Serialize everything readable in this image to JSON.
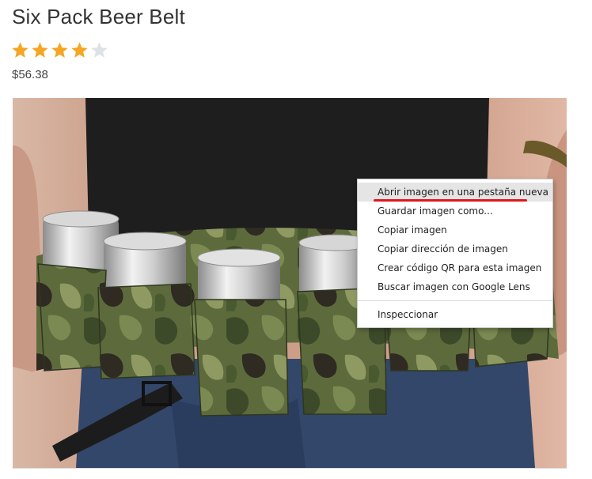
{
  "product": {
    "title": "Six Pack Beer Belt",
    "price": "$56.38",
    "rating": 4,
    "rating_max": 5
  },
  "colors": {
    "star_filled": "#f5a623",
    "star_empty": "#dde3e5",
    "highlight_underline": "#e0161b",
    "menu_hover": "#e5e5e5"
  },
  "context_menu": {
    "items": [
      {
        "label": "Abrir imagen en una pestaña nueva"
      },
      {
        "label": "Guardar imagen como..."
      },
      {
        "label": "Copiar imagen"
      },
      {
        "label": "Copiar dirección de imagen"
      },
      {
        "label": "Crear código QR para esta imagen"
      },
      {
        "label": "Buscar imagen con Google Lens"
      },
      {
        "label": "Inspeccionar"
      }
    ]
  }
}
